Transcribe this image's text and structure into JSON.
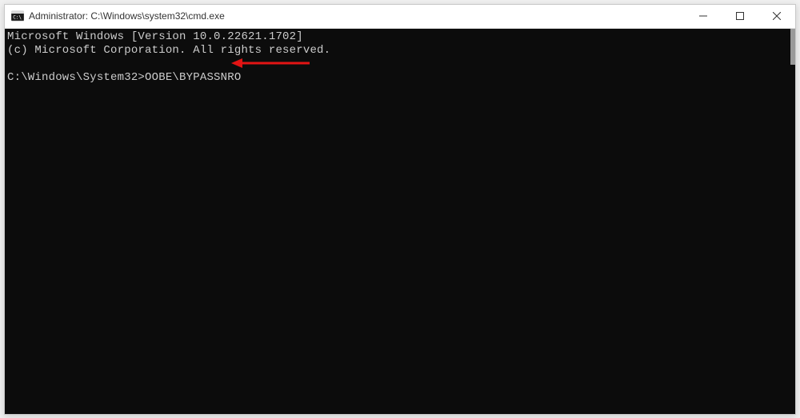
{
  "window": {
    "title": "Administrator: C:\\Windows\\system32\\cmd.exe"
  },
  "terminal": {
    "line1": "Microsoft Windows [Version 10.0.22621.1702]",
    "line2": "(c) Microsoft Corporation. All rights reserved.",
    "blank": "",
    "prompt_line": "C:\\Windows\\System32>OOBE\\BYPASSNRO"
  },
  "icons": {
    "app": "cmd-icon",
    "minimize": "minimize-icon",
    "maximize": "maximize-icon",
    "close": "close-icon"
  },
  "annotation": {
    "arrow_color": "#e31414"
  }
}
